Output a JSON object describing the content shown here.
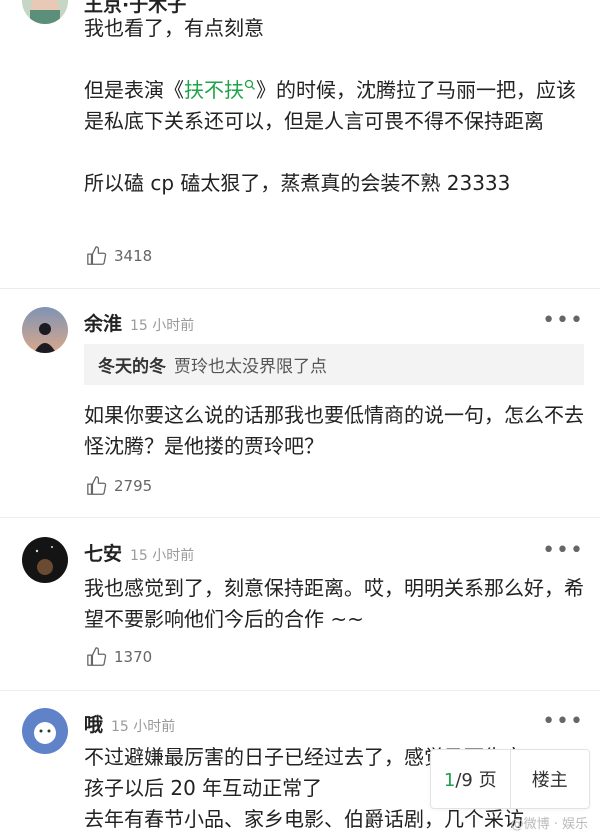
{
  "comments": [
    {
      "name": "王京·于木子",
      "time": "",
      "paragraphs": [
        "我也看了，有点刻意",
        "",
        "所以磕 cp 磕太狠了，蒸煮真的会装不熟 23333"
      ],
      "para2_prefix": "但是表演《",
      "para2_link": "扶不扶",
      "para2_suffix": "》的时候，沈腾拉了马丽一把，应该是私底下关系还可以，但是人言可畏不得不保持距离",
      "likes": "3418"
    },
    {
      "name": "余淮",
      "time": "15 小时前",
      "quote_name": "冬天的冬",
      "quote_text": "贾玲也太没界限了点",
      "text": "如果你要这么说的话那我也要低情商的说一句，怎么不去怪沈腾？是他搂的贾玲吧？",
      "likes": "2795"
    },
    {
      "name": "七安",
      "time": "15 小时前",
      "text": "我也感觉到了，刻意保持距离。哎，明明关系那么好，希望不要影响他们今后的合作 ~~",
      "likes": "1370"
    },
    {
      "name": "哦",
      "time": "15 小时前",
      "text_line1": "不过避嫌最厉害的日子已经过去了，感觉马丽生完",
      "text_line2": "孩子以后 20 年互动正常了",
      "text_line3": "去年有春节小品、家乡电影、伯爵话剧，几个采访"
    }
  ],
  "more_glyph": "•••",
  "pager": {
    "current": "1",
    "total": "/9 页",
    "floor_button": "楼主"
  },
  "watermark": "@微博 · 娱乐"
}
